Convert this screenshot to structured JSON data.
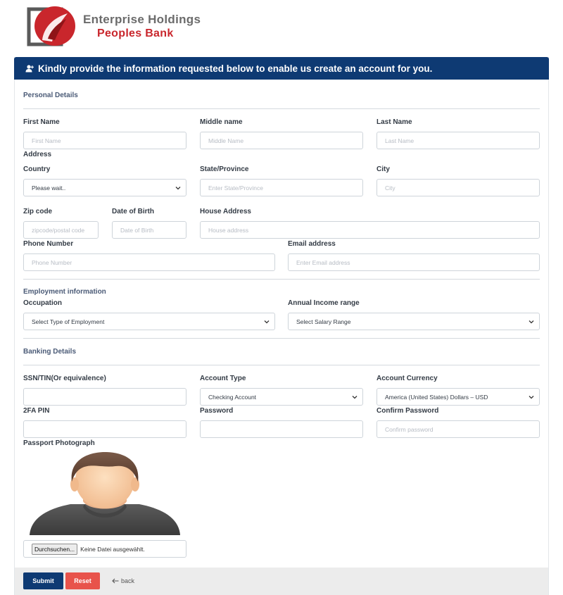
{
  "brand": {
    "line1": "Enterprise Holdings",
    "line2": "Peoples Bank"
  },
  "header": {
    "title": "Kindly provide the information requested below to enable us create an account for you.",
    "icon": "user-plus-icon"
  },
  "sections": {
    "personal": "Personal Details",
    "address": "Address",
    "employment": "Employment information",
    "banking": "Banking Details"
  },
  "fields": {
    "first_name": {
      "label": "First Name",
      "placeholder": "First Name"
    },
    "middle_name": {
      "label": "Middle name",
      "placeholder": "Middle Name"
    },
    "last_name": {
      "label": "Last Name",
      "placeholder": "Last Name"
    },
    "country": {
      "label": "Country",
      "value": "Please wait.."
    },
    "state": {
      "label": "State/Province",
      "placeholder": "Enter State/Province"
    },
    "city": {
      "label": "City",
      "placeholder": "City"
    },
    "zip": {
      "label": "Zip code",
      "placeholder": "zipcode/postal code"
    },
    "dob": {
      "label": "Date of Birth",
      "placeholder": "Date of Birth"
    },
    "house_address": {
      "label": "House Address",
      "placeholder": "House address"
    },
    "phone": {
      "label": "Phone Number",
      "placeholder": "Phone Number"
    },
    "email": {
      "label": "Email address",
      "placeholder": "Enter Email address"
    },
    "occupation": {
      "label": "Occupation",
      "value": "Select Type of Employment"
    },
    "income": {
      "label": "Annual Income range",
      "value": "Select Salary Range"
    },
    "ssn": {
      "label": "SSN/TIN(Or equivalence)",
      "placeholder": ""
    },
    "account_type": {
      "label": "Account Type",
      "value": "Checking Account"
    },
    "account_currency": {
      "label": "Account Currency",
      "value": "America (United States) Dollars – USD"
    },
    "pin": {
      "label": "2FA PIN",
      "placeholder": ""
    },
    "password": {
      "label": "Password",
      "placeholder": ""
    },
    "confirm_password": {
      "label": "Confirm Password",
      "placeholder": "Confirm password"
    },
    "passport": {
      "label": "Passport Photograph",
      "browse": "Durchsuchen...",
      "status": "Keine Datei ausgewählt."
    }
  },
  "actions": {
    "submit": "Submit",
    "reset": "Reset",
    "back": "back"
  },
  "colors": {
    "primary": "#0e3a73",
    "reset": "#e8534b",
    "brand_red": "#c9262c"
  }
}
